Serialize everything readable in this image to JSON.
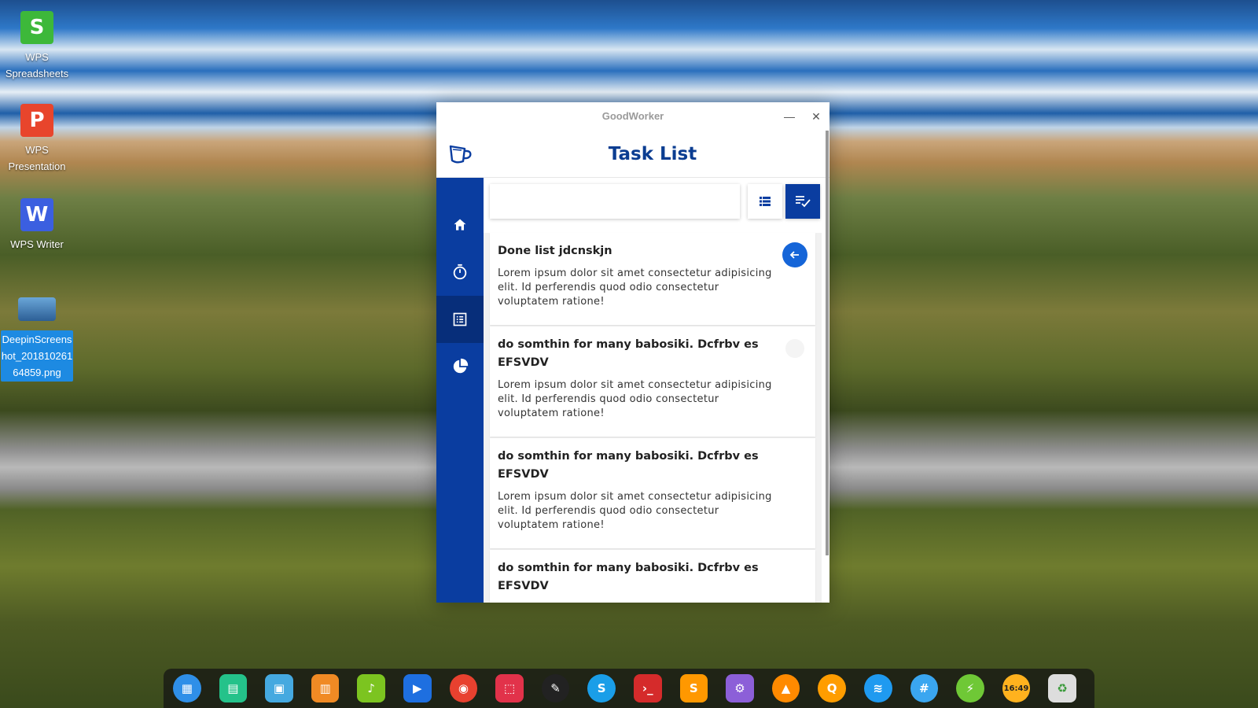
{
  "desktop": {
    "icons": [
      {
        "label": "WPS Spreadsheets",
        "glyph": "S",
        "color": "#3db83a"
      },
      {
        "label": "WPS Presentation",
        "glyph": "P",
        "color": "#e8452c"
      },
      {
        "label": "WPS Writer",
        "glyph": "W",
        "color": "#3b5fe0"
      },
      {
        "label": "DeepinScreenshot_20181026164859.png",
        "glyph": "",
        "color": "#3a78b8"
      }
    ]
  },
  "window": {
    "title": "GoodWorker",
    "minimize_glyph": "—",
    "close_glyph": "✕"
  },
  "app": {
    "header_title": "Task List",
    "logo_icon": "cup-icon",
    "sidebar": [
      {
        "icon": "home-icon",
        "active": false
      },
      {
        "icon": "timer-icon",
        "active": false
      },
      {
        "icon": "list-icon",
        "active": true
      },
      {
        "icon": "pie-chart-icon",
        "active": false
      }
    ],
    "search": {
      "value": "",
      "placeholder": ""
    },
    "toolbar": {
      "list_view_icon": "list-view-icon",
      "done_view_icon": "done-list-icon"
    }
  },
  "tasks": [
    {
      "title": "Done list jdcnskjn",
      "description": "Lorem ipsum dolor sit amet consectetur adipisicing elit. Id perferendis quod odio consectetur voluptatem ratione!",
      "action_icon": "arrow-left-icon"
    },
    {
      "title": "do somthin for many babosiki. Dcfrbv es EFSVDV",
      "description": "Lorem ipsum dolor sit amet consectetur adipisicing elit. Id perferendis quod odio consectetur voluptatem ratione!",
      "action_icon": ""
    },
    {
      "title": "do somthin for many babosiki. Dcfrbv es EFSVDV",
      "description": "Lorem ipsum dolor sit amet consectetur adipisicing elit. Id perferendis quod odio consectetur voluptatem ratione!",
      "action_icon": ""
    },
    {
      "title": "do somthin for many babosiki. Dcfrbv es EFSVDV",
      "description": "",
      "action_icon": ""
    }
  ],
  "dock": {
    "apps": [
      {
        "name": "launcher-icon",
        "color": "#2f8fe8",
        "glyph": "▦"
      },
      {
        "name": "multitasking-icon",
        "color": "#24c28a",
        "glyph": "▤"
      },
      {
        "name": "file-manager-icon",
        "color": "#45a9e0",
        "glyph": "▣"
      },
      {
        "name": "app-store-icon",
        "color": "#f08a24",
        "glyph": "▥"
      },
      {
        "name": "music-icon",
        "color": "#7cc420",
        "glyph": "♪"
      },
      {
        "name": "movie-icon",
        "color": "#1e6fe0",
        "glyph": "▶"
      },
      {
        "name": "chrome-icon",
        "color": "#e8412f",
        "glyph": "◉"
      },
      {
        "name": "screenshot-icon",
        "color": "#e2324a",
        "glyph": "⬚"
      },
      {
        "name": "color-picker-icon",
        "color": "#222222",
        "glyph": "✎"
      },
      {
        "name": "skype-icon",
        "color": "#1a9ee8",
        "glyph": "S"
      },
      {
        "name": "terminal-icon",
        "color": "#d52b2b",
        "glyph": "›_"
      },
      {
        "name": "sublime-icon",
        "color": "#ff9800",
        "glyph": "S"
      },
      {
        "name": "settings-app-icon",
        "color": "#8c5fd8",
        "glyph": "⚙"
      },
      {
        "name": "vlc-icon",
        "color": "#ff8a00",
        "glyph": "▲"
      },
      {
        "name": "browser-icon",
        "color": "#ff9d00",
        "glyph": "Q"
      },
      {
        "name": "wifi-icon",
        "color": "#1f9af0",
        "glyph": "≋"
      },
      {
        "name": "control-center-icon",
        "color": "#3aa6f0",
        "glyph": "#"
      },
      {
        "name": "power-icon",
        "color": "#6fc836",
        "glyph": "⚡"
      },
      {
        "name": "clock-icon",
        "color": "#ffb21e",
        "glyph": "16:49"
      },
      {
        "name": "trash-icon",
        "color": "#dddddd",
        "glyph": "♻"
      }
    ]
  }
}
